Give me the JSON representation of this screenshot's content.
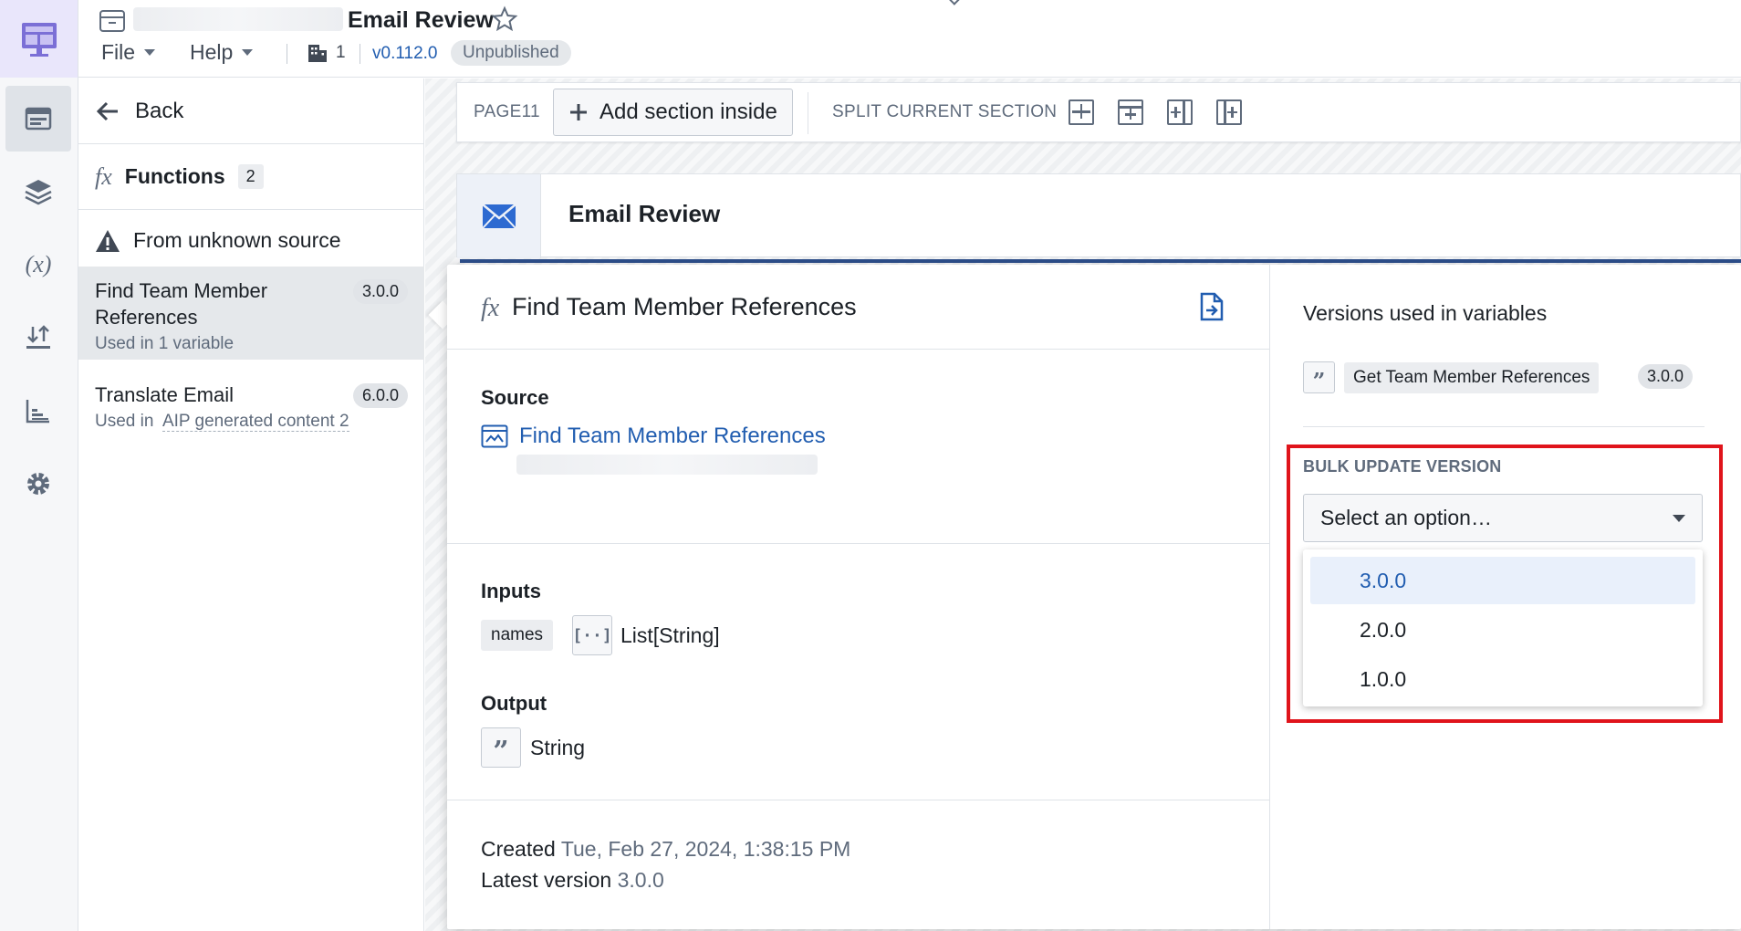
{
  "header": {
    "title": "Email Review",
    "menu_file": "File",
    "menu_help": "Help",
    "org_count": "1",
    "version": "v0.112.0",
    "status": "Unpublished"
  },
  "sidebar": {
    "back_label": "Back",
    "functions_label": "Functions",
    "functions_count": "2",
    "unknown_source_label": "From unknown source",
    "items": [
      {
        "name": "Find Team Member References",
        "version": "3.0.0",
        "usage": "Used in 1 variable",
        "selected": true
      },
      {
        "name": "Translate Email",
        "version": "6.0.0",
        "usage_prefix": "Used in",
        "usage_link": "AIP generated content 2",
        "selected": false
      }
    ]
  },
  "toolbar": {
    "page_label": "PAGE11",
    "add_section_label": "Add section inside",
    "split_label": "SPLIT CURRENT SECTION"
  },
  "section": {
    "title": "Email Review"
  },
  "detail": {
    "title": "Find Team Member References",
    "source_label": "Source",
    "source_link": "Find Team Member References",
    "inputs_label": "Inputs",
    "input_name": "names",
    "input_type": "List[String]",
    "output_label": "Output",
    "output_type": "String",
    "created_label": "Created",
    "created_value": "Tue, Feb 27, 2024, 1:38:15 PM",
    "latest_label": "Latest version",
    "latest_value": "3.0.0"
  },
  "versions": {
    "title": "Versions used in variables",
    "variable_name": "Get Team Member References",
    "variable_version": "3.0.0",
    "bulk_label": "BULK UPDATE VERSION",
    "select_placeholder": "Select an option…",
    "options": [
      "3.0.0",
      "2.0.0",
      "1.0.0"
    ],
    "selected_option": "3.0.0"
  },
  "colors": {
    "accent": "#215db0",
    "highlight": "#e0141b",
    "section_bar": "#2d4f8c"
  }
}
